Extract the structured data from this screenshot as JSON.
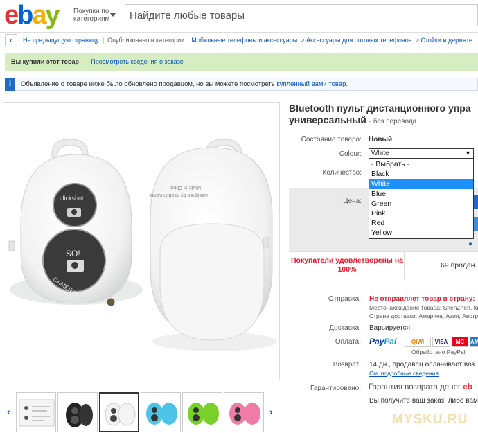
{
  "header": {
    "logo_letters": [
      "e",
      "b",
      "a",
      "y"
    ],
    "categories_label": "Покупки по категориям",
    "search_placeholder": "Найдите любые товары"
  },
  "breadcrumb": {
    "back_label": "На предыдущую страницу",
    "published_label": "Опубликовано в категории:",
    "items": [
      "Мобильные телефоны и аксессуары",
      "Аксессуары для сотовых телефонов",
      "Стойки и держате"
    ]
  },
  "purchase_bar": {
    "status": "Вы купили этот товар",
    "link": "Просмотреть сведения о заказе"
  },
  "info_bar": {
    "icon": "i",
    "text": "Объявление о товаре ниже было обновлено продавцом, но вы можете посмотреть",
    "link": "купленный вами товар."
  },
  "product": {
    "title_line1": "Bluetooth пульт дистанционного упра",
    "title_line2": "универсальный",
    "title_note": "- без перевода",
    "condition_label": "Состояние товара:",
    "condition_value": "Новый",
    "colour_label": "Colour:",
    "colour_selected": "White",
    "colour_options": [
      "- Выбрать -",
      "Black",
      "White",
      "Blue",
      "Green",
      "Pink",
      "Red",
      "Yellow"
    ],
    "highlighted_option_index": 2,
    "quantity_label": "Количество:",
    "price_label": "Цена:",
    "buyers_satisfied": "Покупатели удовлетворены на 100%",
    "sold": "69 продан"
  },
  "shipping": {
    "shipping_label": "Отправка:",
    "shipping_value": "Не отправляет товар в страну:",
    "location": "Местонахождение товара: ShenZhen, Кита",
    "ship_to": "Страна доставки: Америка, Азия, Австрал",
    "delivery_label": "Доставка:",
    "delivery_value": "Варьируется",
    "payment_label": "Оплата:",
    "paypal_1": "Pay",
    "paypal_2": "Pal",
    "cards": [
      "QIWI",
      "VISA",
      "MC",
      "AMEX"
    ],
    "paypal_note": "Обработано PayPal",
    "return_label": "Возврат:",
    "return_value": "14 дн., продавец оплачивает воз",
    "return_link": "См. подробные сведения",
    "guarantee_label": "Гарантировано:",
    "guarantee_value": "Гарантия возврата денег",
    "guarantee_brand": "eb",
    "guarantee_note": "Вы получите ваш заказ, либо вам вер"
  },
  "device_text": {
    "logo_small": "clickshot",
    "selfie": "SO!",
    "camera": "CAMERA 360",
    "back_small": "Designed by Asoft in Korea",
    "back_small2": "Made in China"
  },
  "thumbnails": [
    {
      "name": "thumb-manual",
      "color": "#f4f4f4"
    },
    {
      "name": "thumb-black",
      "color": "#222222"
    },
    {
      "name": "thumb-white",
      "color": "#f2f2f2"
    },
    {
      "name": "thumb-blue",
      "color": "#4ec3e8"
    },
    {
      "name": "thumb-green",
      "color": "#7ad02a"
    },
    {
      "name": "thumb-pink",
      "color": "#f27aa6"
    }
  ],
  "watermark": "MYSKU.RU"
}
